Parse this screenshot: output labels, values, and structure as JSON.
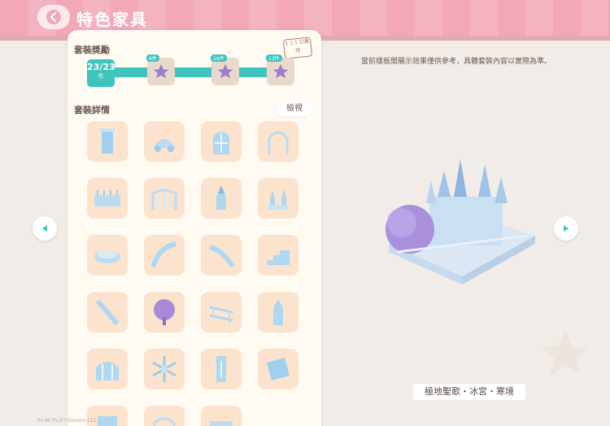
{
  "header": {
    "title": "特色家具"
  },
  "left_panel": {
    "reward_label": "套裝獎勵",
    "progress": {
      "value": "23/23",
      "unit": "件"
    },
    "milestones": [
      {
        "tag": "8件"
      },
      {
        "tag": "16件"
      },
      {
        "tag": "23件"
      }
    ],
    "stamp_text": "1 1 1 已獲得",
    "details_label": "套裝詳情",
    "view_button": "檢視"
  },
  "right_panel": {
    "notice": "當前樣板間展示效果僅供參考，具體套裝內容以實際為準。",
    "caption": "極地聖歌・冰宮・寒境"
  },
  "footer": {
    "text": "Pv.90  Pv.97  IDoconv112"
  },
  "colors": {
    "teal": "#3fc3bd",
    "pink": "#f2a8b6",
    "cell": "#fbe3cd"
  }
}
